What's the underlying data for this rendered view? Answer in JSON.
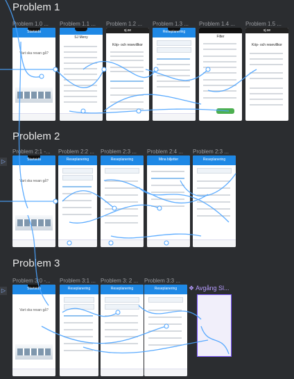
{
  "sections": [
    {
      "title": "Problem 1",
      "frames": [
        {
          "label": "Problem 1.0 ...",
          "screen": "Startsida",
          "subtitle": "Vart ska resan gå?"
        },
        {
          "label": "Problem 1.1 ...",
          "screen": "SJ Meny"
        },
        {
          "label": "Problem 1.2 ...",
          "screen": "sj.se",
          "subtitle": "Köp- och resevillkor"
        },
        {
          "label": "Problem 1.3 ...",
          "screen": "Reseplanering"
        },
        {
          "label": "Problem 1.4 ...",
          "screen": "Filter"
        },
        {
          "label": "Problem 1.5 ...",
          "screen": "sj.se",
          "subtitle": "Köp- och resevillkor"
        }
      ]
    },
    {
      "title": "Problem 2",
      "frames": [
        {
          "label": "Problem 2:1 -...",
          "screen": "Startsida",
          "subtitle": "Vart ska resan gå?"
        },
        {
          "label": "Problem 2:2 ...",
          "screen": "Reseplanering"
        },
        {
          "label": "Problem 2:3 ...",
          "screen": "Reseplanering"
        },
        {
          "label": "Problem 2:4 ...",
          "screen": "Mina biljetter"
        },
        {
          "label": "Problem 2:3 ...",
          "screen": "Reseplanering"
        }
      ]
    },
    {
      "title": "Problem 3",
      "frames": [
        {
          "label": "Problem 3:0 -...",
          "screen": "Startsida",
          "subtitle": "Vart ska resan gå?"
        },
        {
          "label": "Problem 3:1 ...",
          "screen": "Reseplanering"
        },
        {
          "label": "Problem 3: 2 ...",
          "screen": "Reseplanering"
        },
        {
          "label": "Problem 3:3 ...",
          "screen": "Reseplanering"
        }
      ]
    }
  ],
  "prototype_flow_label": "Avgång Sl...",
  "colors": {
    "canvas": "#2b2d30",
    "connector": "#4aa3ff",
    "app_blue": "#1e88e5",
    "section_text": "#e8e8e8",
    "frame_label": "#9a9ca0",
    "accent_purple": "#7b57ff"
  }
}
